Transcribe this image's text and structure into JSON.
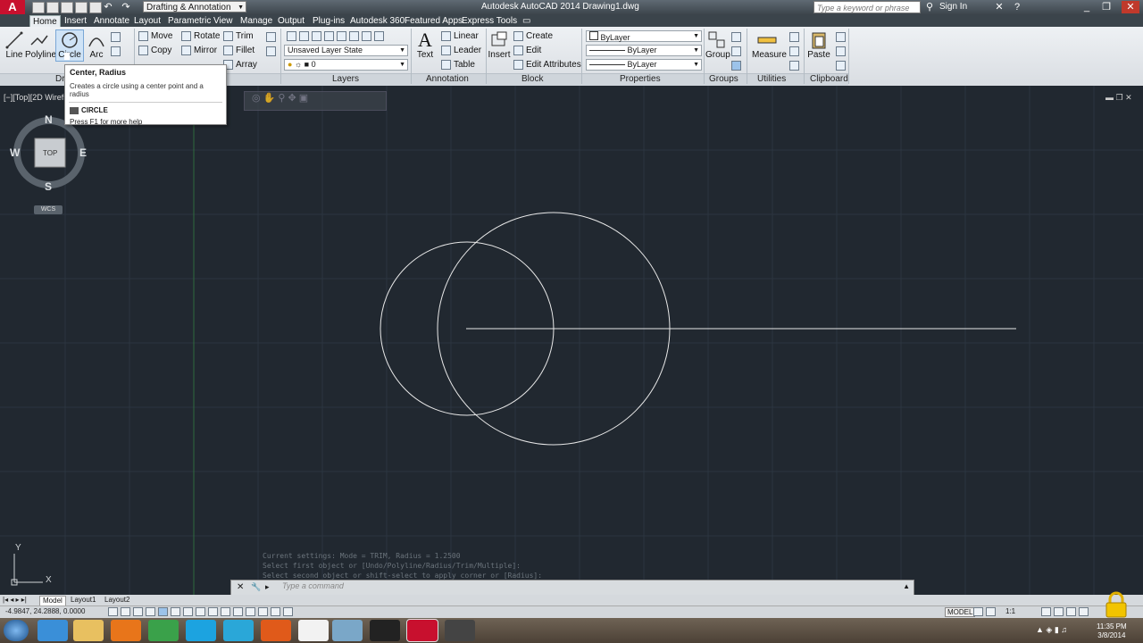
{
  "title_bar": {
    "workspace": "Drafting & Annotation",
    "title": "Autodesk AutoCAD 2014    Drawing1.dwg",
    "search_placeholder": "Type a keyword or phrase",
    "sign_in": "Sign In"
  },
  "tabs": [
    "Home",
    "Insert",
    "Annotate",
    "Layout",
    "Parametric",
    "View",
    "Manage",
    "Output",
    "Plug-ins",
    "Autodesk 360",
    "Featured Apps",
    "Express Tools"
  ],
  "ribbon": {
    "draw": {
      "line": "Line",
      "polyline": "Polyline",
      "circle": "Circle",
      "arc": "Arc",
      "panel_title": "Draw"
    },
    "modify": {
      "move": "Move",
      "copy": "Copy",
      "rotate": "Rotate",
      "mirror": "Mirror",
      "trim": "Trim",
      "fillet": "Fillet",
      "array": "Array"
    },
    "layers": {
      "layer_state": "Unsaved Layer State",
      "layer_current": "0",
      "panel_title": "Layers"
    },
    "annotation": {
      "text": "Text",
      "linear": "Linear",
      "leader": "Leader",
      "table": "Table",
      "panel_title": "Annotation"
    },
    "block": {
      "insert": "Insert",
      "create": "Create",
      "edit": "Edit",
      "edit_attributes": "Edit Attributes",
      "panel_title": "Block"
    },
    "properties": {
      "color": "ByLayer",
      "linetype": "ByLayer",
      "lineweight": "ByLayer",
      "panel_title": "Properties"
    },
    "groups": {
      "group": "Group",
      "panel_title": "Groups"
    },
    "utilities": {
      "measure": "Measure",
      "panel_title": "Utilities"
    },
    "clipboard": {
      "paste": "Paste",
      "panel_title": "Clipboard"
    }
  },
  "tooltip": {
    "title": "Center, Radius",
    "description": "Creates a circle using a center point and a radius",
    "command": "CIRCLE",
    "help": "Press F1 for more help"
  },
  "viewport": {
    "label": "[−][Top][2D Wirefra",
    "viewcube": {
      "n": "N",
      "s": "S",
      "e": "E",
      "w": "W",
      "face": "TOP"
    },
    "wcs": "WCS",
    "ucs_y": "Y",
    "ucs_x": "X"
  },
  "command": {
    "history": [
      "Current settings: Mode = TRIM, Radius = 1.2500",
      "Select first object or [Undo/Polyline/Radius/Trim/Multiple]:",
      "Select second object or shift-select to apply corner or [Radius]:"
    ],
    "placeholder": "Type a command"
  },
  "layout_tabs": [
    "Model",
    "Layout1",
    "Layout2"
  ],
  "status": {
    "coords": "-4.9847, 24.2888, 0.0000",
    "model": "MODEL",
    "scale": "1:1"
  },
  "clock": {
    "time": "11:35 PM",
    "date": "3/8/2014"
  },
  "colors": {
    "viewport_bg": "#212830",
    "geometry": "#e8e8e8",
    "accent": "#c8102e"
  }
}
